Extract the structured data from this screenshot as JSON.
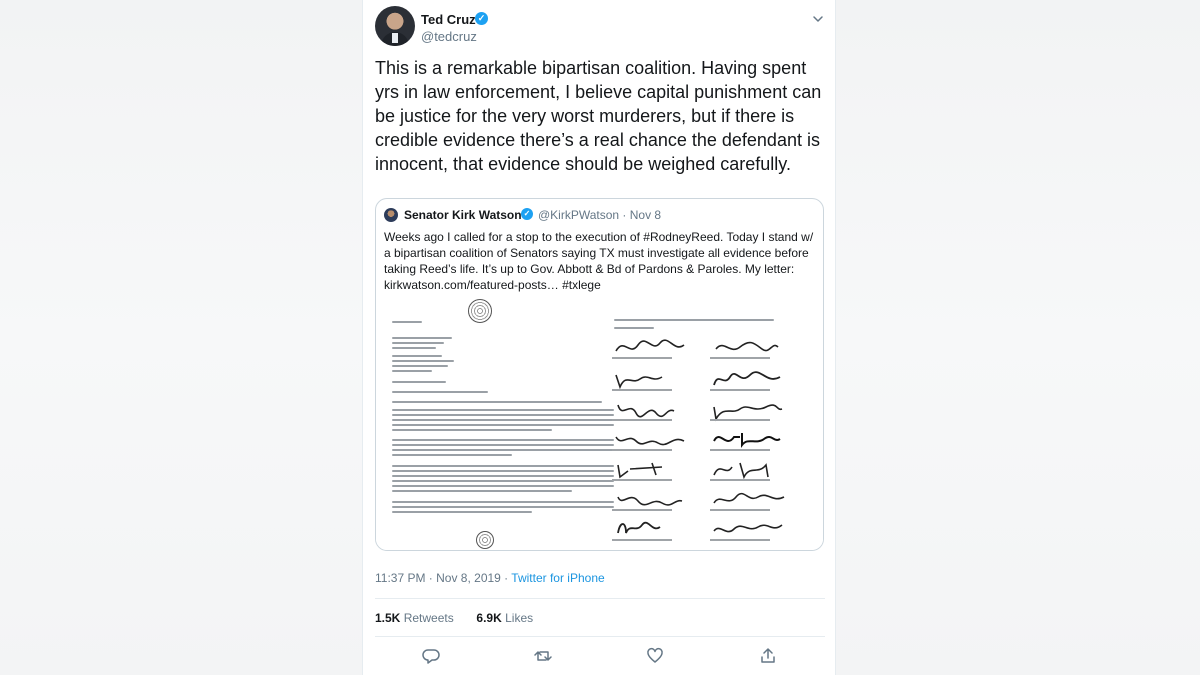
{
  "author": {
    "display_name": "Ted Cruz",
    "handle": "@tedcruz",
    "verified": true
  },
  "tweet": {
    "text": "This is a remarkable bipartisan coalition. Having spent yrs in law enforcement, I believe capital punishment can be justice for the very worst murderers, but if there is credible evidence there’s a real chance the defendant is innocent, that evidence should be weighed carefully."
  },
  "quoted_tweet": {
    "display_name": "Senator Kirk Watson",
    "handle_date": "@KirkPWatson · Nov 8",
    "text": "Weeks ago I called for a stop to the execution of #RodneyReed. Today I stand w/ a bipartisan coalition of Senators saying TX must investigate all evidence before taking Reed’s life. It’s up to Gov. Abbott & Bd of Pardons & Paroles. My letter: kirkwatson.com/featured-posts… #txlege"
  },
  "meta": {
    "time_date": "11:37 PM · Nov 8, 2019 · ",
    "source": "Twitter for iPhone"
  },
  "stats": {
    "retweets_count": "1.5K",
    "retweets_label": "Retweets",
    "likes_count": "6.9K",
    "likes_label": "Likes"
  },
  "icons": {
    "menu": "chevron-down-icon",
    "reply": "reply-icon",
    "retweet": "retweet-icon",
    "like": "heart-icon",
    "share": "share-icon"
  },
  "colors": {
    "accent": "#1da1f2",
    "link": "#1b95e0",
    "text_primary": "#14171a",
    "text_secondary": "#657786"
  }
}
